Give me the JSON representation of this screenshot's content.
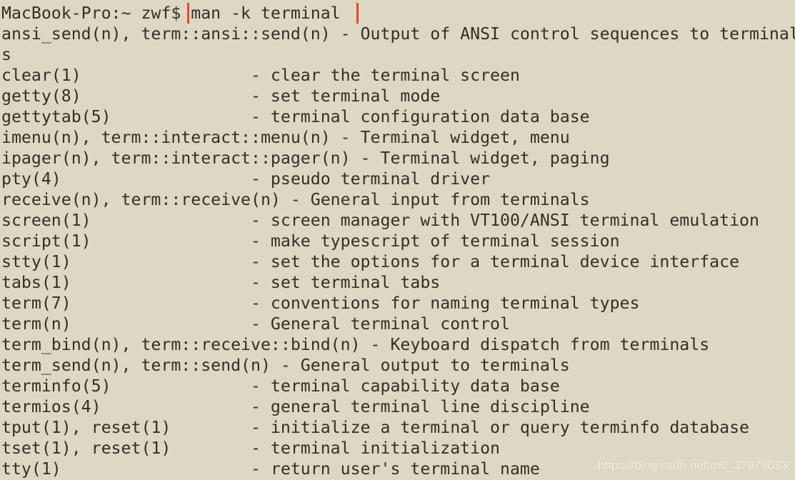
{
  "prompt": {
    "text": "MacBook-Pro:~ zwf$ ",
    "command": "man -k terminal"
  },
  "highlight_color": "#e8472f",
  "lines": [
    "ansi_send(n), term::ansi::send(n) - Output of ANSI control sequences to terminal",
    "s",
    "clear(1)                 - clear the terminal screen",
    "getty(8)                 - set terminal mode",
    "gettytab(5)              - terminal configuration data base",
    "imenu(n), term::interact::menu(n) - Terminal widget, menu",
    "ipager(n), term::interact::pager(n) - Terminal widget, paging",
    "pty(4)                   - pseudo terminal driver",
    "receive(n), term::receive(n) - General input from terminals",
    "screen(1)                - screen manager with VT100/ANSI terminal emulation",
    "script(1)                - make typescript of terminal session",
    "stty(1)                  - set the options for a terminal device interface",
    "tabs(1)                  - set terminal tabs",
    "term(7)                  - conventions for naming terminal types",
    "term(n)                  - General terminal control",
    "term_bind(n), term::receive::bind(n) - Keyboard dispatch from terminals",
    "term_send(n), term::send(n) - General output to terminals",
    "terminfo(5)              - terminal capability data base",
    "termios(4)               - general terminal line discipline",
    "tput(1), reset(1)        - initialize a terminal or query terminfo database",
    "tset(1), reset(1)        - terminal initialization",
    "tty(1)                   - return user's terminal name"
  ],
  "watermark": "https://blog.csdn.net/m0_37979033"
}
